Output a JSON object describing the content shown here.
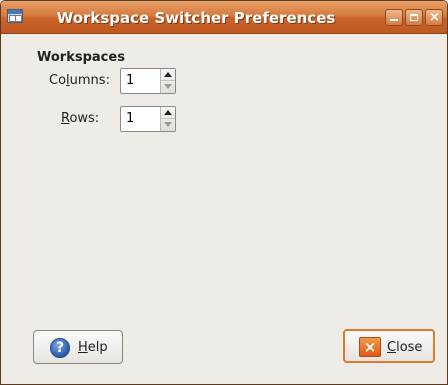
{
  "window": {
    "title": "Workspace Switcher Preferences",
    "controls": {
      "minimize_icon": "minimize-icon",
      "maximize_icon": "maximize-icon",
      "close_icon": "close-icon",
      "close_glyph": "×"
    }
  },
  "workspaces": {
    "section_title": "Workspaces",
    "columns": {
      "label_pre": "Co",
      "label_mnemonic": "l",
      "label_post": "umns:",
      "value": "1"
    },
    "rows": {
      "label_pre": "",
      "label_mnemonic": "R",
      "label_post": "ows:",
      "value": "1"
    }
  },
  "buttons": {
    "help": {
      "mnemonic": "H",
      "rest": "elp",
      "icon": "help-icon",
      "icon_glyph": "?"
    },
    "close": {
      "mnemonic": "C",
      "rest": "lose",
      "icon": "close-icon",
      "icon_glyph": "×"
    }
  },
  "colors": {
    "titlebar": "#c9622a",
    "focus_border": "#e07a2e",
    "window_bg": "#efebe7"
  }
}
